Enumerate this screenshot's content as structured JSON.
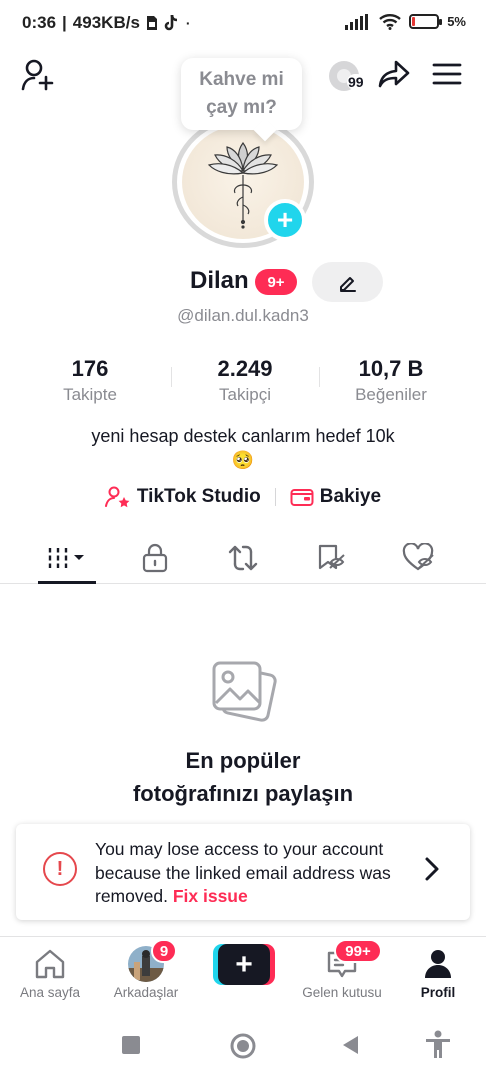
{
  "status_bar": {
    "time": "0:36",
    "speed": "493KB/s",
    "battery": "5%"
  },
  "header": {
    "story_count": "99"
  },
  "profile": {
    "bubble_text_line1": "Kahve mi",
    "bubble_text_line2": "çay mı?",
    "name": "Dilan",
    "notification_badge": "9+",
    "handle": "@dilan.dul.kadn3",
    "stats": [
      {
        "value": "176",
        "label": "Takipte"
      },
      {
        "value": "2.249",
        "label": "Takipçi"
      },
      {
        "value": "10,7 B",
        "label": "Beğeniler"
      }
    ],
    "bio": "yeni hesap destek canlarım hedef 10k",
    "bio_emoji": "🥺",
    "studio_label": "TikTok Studio",
    "wallet_label": "Bakiye"
  },
  "empty_state": {
    "line1": "En popüler",
    "line2": "fotoğrafınızı paylaşın"
  },
  "warning": {
    "message": "You may lose access to your account because the linked email address was removed.",
    "link": "Fix issue"
  },
  "bottom_nav": {
    "home": "Ana sayfa",
    "friends": "Arkadaşlar",
    "friends_badge": "9",
    "inbox": "Gelen kutusu",
    "inbox_badge": "99+",
    "profile": "Profil"
  },
  "colors": {
    "brand_red": "#fe2c55",
    "brand_cyan": "#20d5ec",
    "text_dark": "#161823",
    "text_gray": "#8a8b91"
  }
}
